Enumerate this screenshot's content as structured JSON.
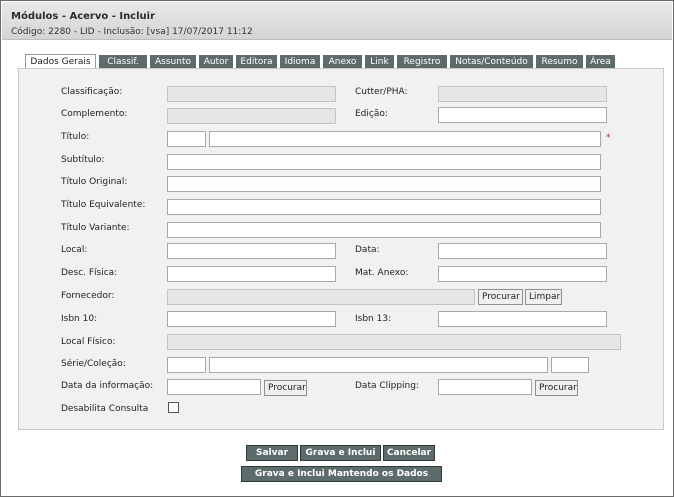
{
  "window": {
    "title": "Módulos - Acervo - Incluir",
    "subtitle": "Código: 2280 - LID - Inclusão: [vsa] 17/07/2017 11:12"
  },
  "tabs": [
    {
      "label": "Dados Gerais",
      "active": true
    },
    {
      "label": "Classif."
    },
    {
      "label": "Assunto"
    },
    {
      "label": "Autor"
    },
    {
      "label": "Editora"
    },
    {
      "label": "Idioma"
    },
    {
      "label": "Anexo"
    },
    {
      "label": "Link"
    },
    {
      "label": "Registro"
    },
    {
      "label": "Notas/Conteúdo"
    },
    {
      "label": "Resumo"
    },
    {
      "label": "Área"
    }
  ],
  "form": {
    "classificacao": "Classificação:",
    "cutter": "Cutter/PHA:",
    "complemento": "Complemento:",
    "edicao": "Edição:",
    "titulo": "Título:",
    "required_mark": "*",
    "subtitulo": "Subtítulo:",
    "titulo_original": "Título Original:",
    "titulo_equivalente": "Título Equivalente:",
    "titulo_variante": "Título Variante:",
    "local": "Local:",
    "data": "Data:",
    "desc_fisica": "Desc. Física:",
    "mat_anexo": "Mat. Anexo:",
    "fornecedor": "Fornecedor:",
    "procurar": "Procurar",
    "limpar": "Limpar",
    "isbn10": "Isbn 10:",
    "isbn13": "Isbn 13:",
    "local_fisico": "Local Físico:",
    "serie_colecao": "Série/Coleção:",
    "data_informacao": "Data da informação:",
    "data_clipping": "Data Clipping:",
    "desabilita_consulta": "Desabilita Consulta"
  },
  "actions": {
    "salvar": "Salvar",
    "grava_inclui": "Grava e Inclui",
    "cancelar": "Cancelar",
    "grava_inclui_mantendo": "Grava e Inclui Mantendo os Dados"
  }
}
